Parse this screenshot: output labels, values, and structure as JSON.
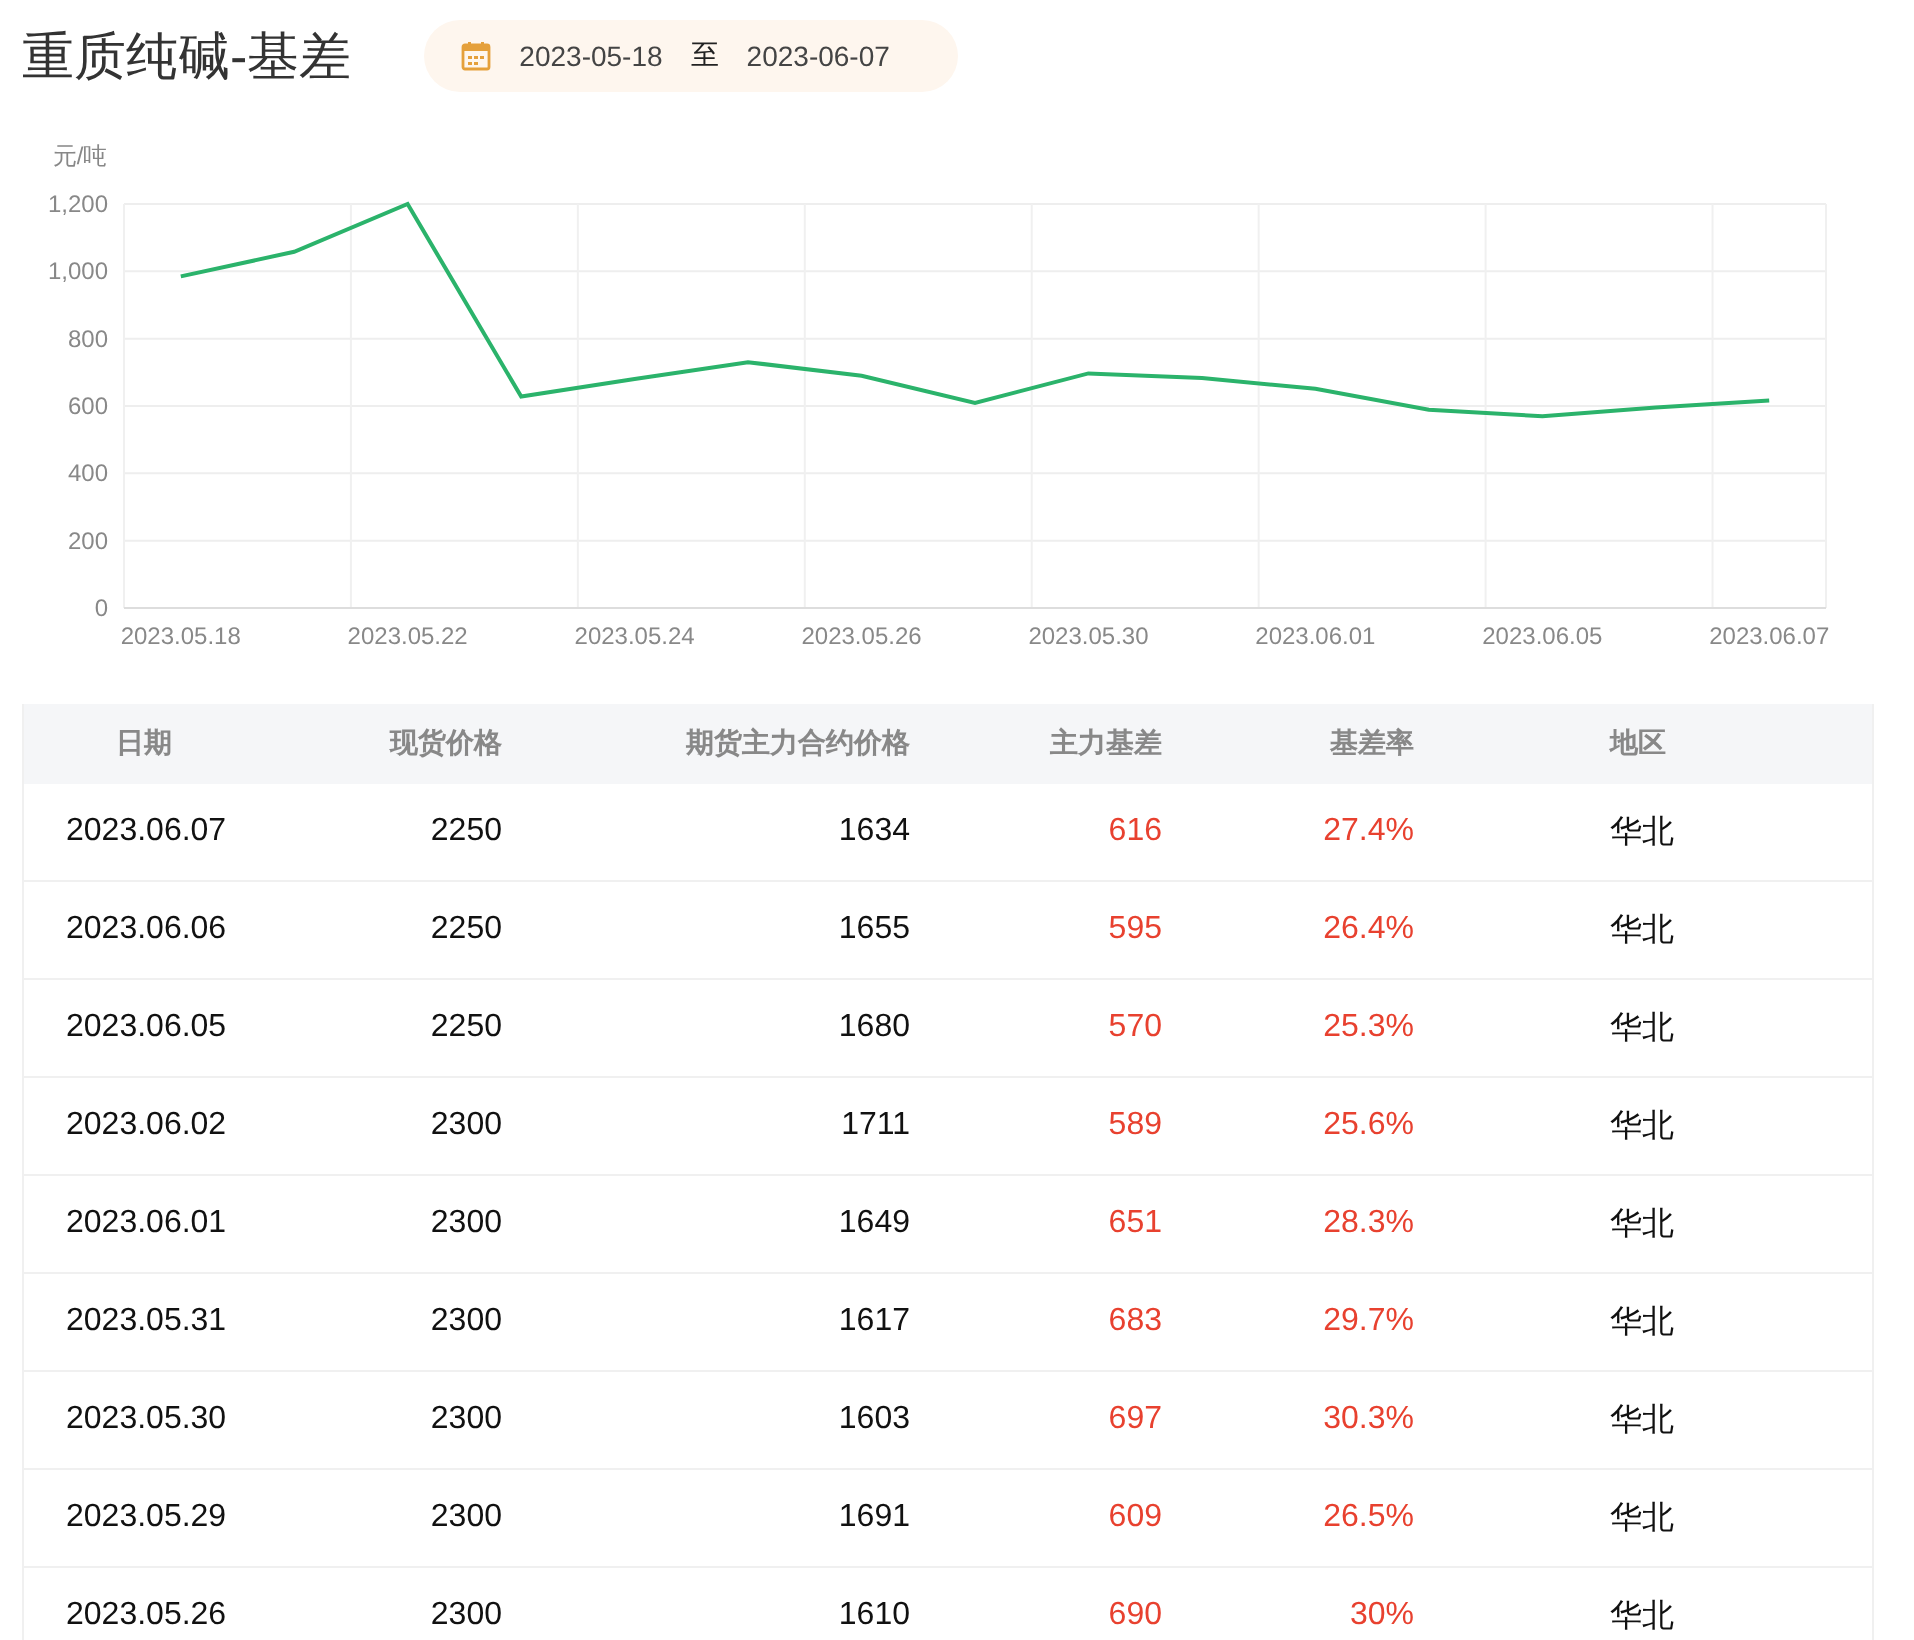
{
  "title": "重质纯碱-基差",
  "date_range": {
    "start": "2023-05-18",
    "separator": "至",
    "end": "2023-06-07"
  },
  "chart": {
    "chart_data": {
      "type": "line",
      "ylabel": "元/吨",
      "categories": [
        "2023.05.18",
        null,
        "2023.05.22",
        null,
        "2023.05.24",
        null,
        "2023.05.26",
        null,
        "2023.05.30",
        null,
        "2023.06.01",
        null,
        "2023.06.05",
        null,
        "2023.06.07"
      ],
      "grid": true,
      "series": [
        {
          "color": "#2bb36b",
          "values": [
            985,
            1058,
            1200,
            628,
            680,
            730,
            690,
            609,
            697,
            683,
            651,
            589,
            570,
            595,
            616
          ]
        }
      ],
      "ylim": [
        0,
        1200
      ],
      "yticks": [
        {
          "value": 0,
          "label": "0"
        },
        {
          "value": 200,
          "label": "200"
        },
        {
          "value": 400,
          "label": "400"
        },
        {
          "value": 600,
          "label": "600"
        },
        {
          "value": 800,
          "label": "800"
        },
        {
          "value": 1000,
          "label": "1,000"
        },
        {
          "value": 1200,
          "label": "1,200"
        }
      ]
    }
  },
  "table": {
    "columns": [
      "日期",
      "现货价格",
      "期货主力合约价格",
      "主力基差",
      "基差率",
      "地区"
    ],
    "rows": [
      [
        "2023.06.07",
        "2250",
        "1634",
        "616",
        "27.4%",
        "华北"
      ],
      [
        "2023.06.06",
        "2250",
        "1655",
        "595",
        "26.4%",
        "华北"
      ],
      [
        "2023.06.05",
        "2250",
        "1680",
        "570",
        "25.3%",
        "华北"
      ],
      [
        "2023.06.02",
        "2300",
        "1711",
        "589",
        "25.6%",
        "华北"
      ],
      [
        "2023.06.01",
        "2300",
        "1649",
        "651",
        "28.3%",
        "华北"
      ],
      [
        "2023.05.31",
        "2300",
        "1617",
        "683",
        "29.7%",
        "华北"
      ],
      [
        "2023.05.30",
        "2300",
        "1603",
        "697",
        "30.3%",
        "华北"
      ],
      [
        "2023.05.29",
        "2300",
        "1691",
        "609",
        "26.5%",
        "华北"
      ],
      [
        "2023.05.26",
        "2300",
        "1610",
        "690",
        "30%",
        "华北"
      ]
    ]
  }
}
